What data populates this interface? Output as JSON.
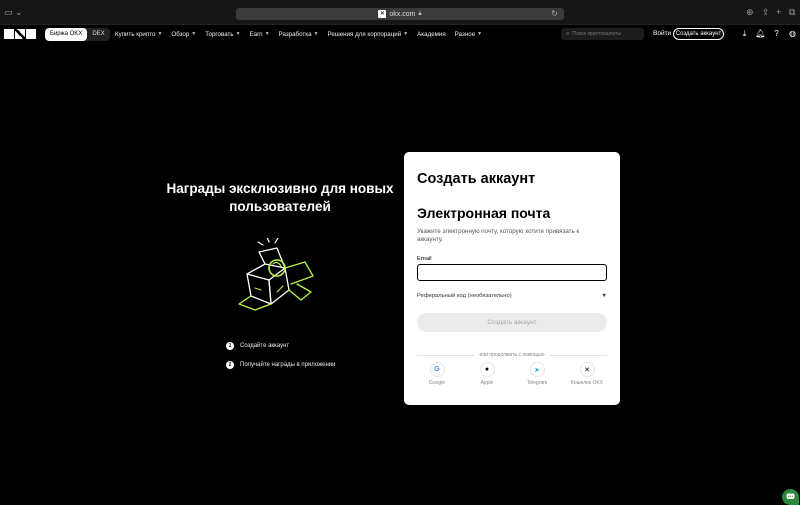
{
  "browser": {
    "url": "okx.com"
  },
  "nav": {
    "exchange_label": "Биржа OKX",
    "dex_label": "DEX",
    "menu": [
      {
        "label": "Купить крипто"
      },
      {
        "label": "Обзор"
      },
      {
        "label": "Торговать"
      },
      {
        "label": "Earn"
      },
      {
        "label": "Разработка"
      },
      {
        "label": "Решения для корпораций"
      },
      {
        "label": "Академия"
      },
      {
        "label": "Разное"
      }
    ],
    "search_placeholder": "Поиск криптовалюты",
    "login_label": "Войти",
    "signup_label": "Создать аккаунт"
  },
  "promo": {
    "title": "Награды эксклюзивно для новых пользователей",
    "steps": [
      {
        "num": "1",
        "text": "Создайте аккаунт"
      },
      {
        "num": "2",
        "text": "Получайте награды в приложении"
      }
    ]
  },
  "form": {
    "title": "Создать аккаунт",
    "subtitle": "Электронная почта",
    "description": "Укажите электронную почту, которую хотите привязать к аккаунту.",
    "email_label": "Email",
    "email_value": "",
    "referral_label": "Реферальный код (необязательно)",
    "submit_label": "Создать аккаунт",
    "divider_text": "или продолжить с помощью",
    "socials": [
      {
        "label": "Google",
        "icon": "google-icon"
      },
      {
        "label": "Apple",
        "icon": "apple-icon"
      },
      {
        "label": "Telegram",
        "icon": "telegram-icon"
      },
      {
        "label": "Кошелек OKX",
        "icon": "okx-wallet-icon"
      }
    ]
  },
  "colors": {
    "accent_green": "#b7f34a",
    "chat_green": "#2a8a3a"
  }
}
